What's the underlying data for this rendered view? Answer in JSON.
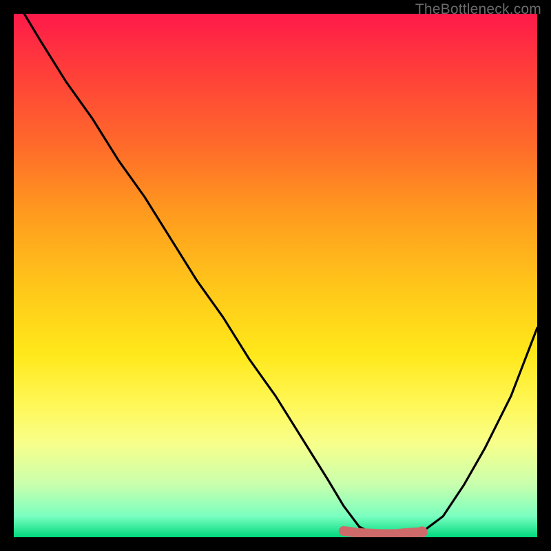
{
  "watermark": "TheBottleneck.com",
  "chart_data": {
    "type": "line",
    "title": "",
    "xlabel": "",
    "ylabel": "",
    "xlim": [
      0,
      100
    ],
    "ylim": [
      0,
      100
    ],
    "grid": false,
    "legend": false,
    "series": [
      {
        "name": "bottleneck-curve",
        "x": [
          2,
          5,
          10,
          15,
          20,
          25,
          30,
          35,
          40,
          45,
          50,
          55,
          60,
          63,
          66,
          70,
          73,
          75,
          78,
          82,
          86,
          90,
          95,
          100
        ],
        "values": [
          100,
          95,
          87,
          80,
          72,
          65,
          57,
          49,
          42,
          34,
          27,
          19,
          11,
          6,
          2,
          0,
          0,
          0,
          1,
          4,
          10,
          17,
          27,
          40
        ]
      },
      {
        "name": "optimal-band",
        "x": [
          63,
          66,
          70,
          73,
          75,
          78
        ],
        "values": [
          1.2,
          0.8,
          0.6,
          0.6,
          0.8,
          1.0
        ]
      }
    ],
    "annotations": [
      {
        "name": "optimal-band-marker",
        "x_range": [
          63,
          78
        ],
        "color": "#cf6a6a"
      }
    ],
    "colors": {
      "curve": "#000000",
      "optimal_band": "#cf6a6a",
      "gradient_top": "#ff1a4a",
      "gradient_bottom": "#00d97e"
    }
  }
}
